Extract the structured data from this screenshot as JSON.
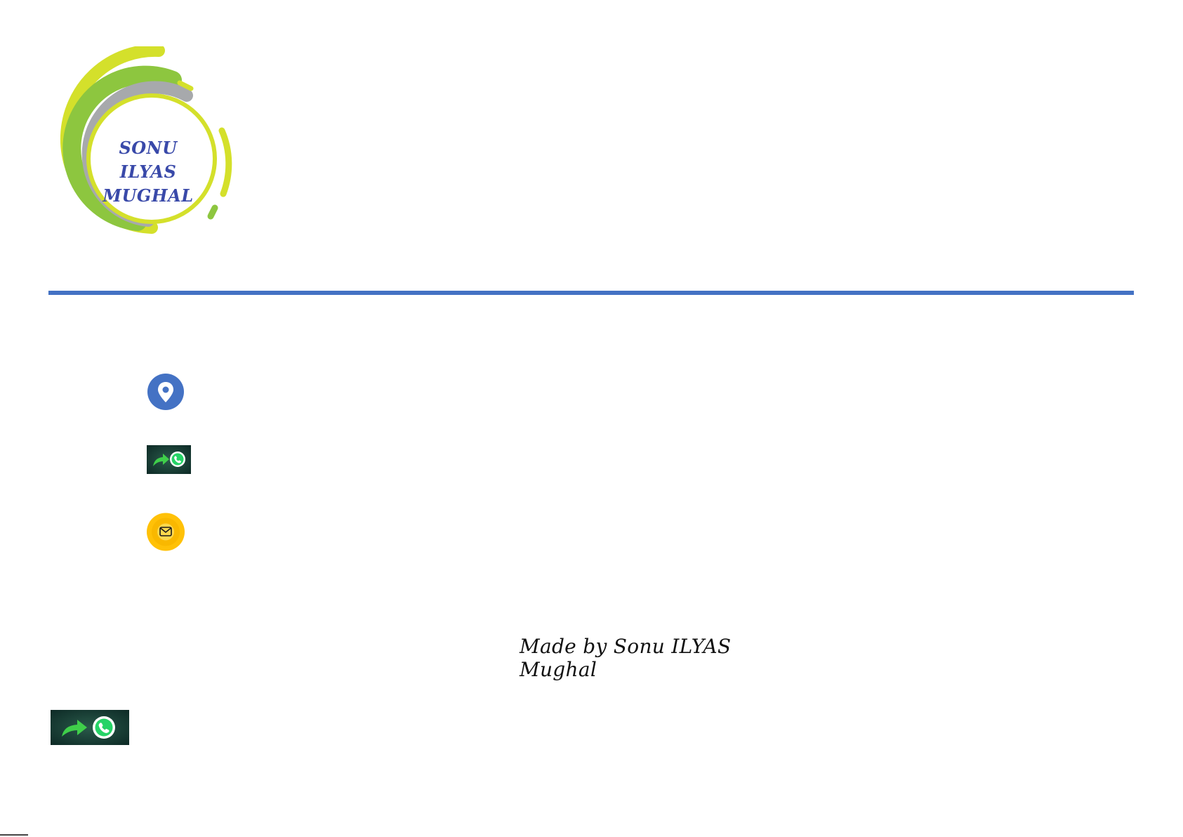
{
  "logo": {
    "line1": "SONU ILYAS",
    "line2": "MUGHAL",
    "colors": {
      "lime": "#d4e02b",
      "green": "#8dc63f",
      "gray": "#a7a9ac",
      "text": "#3949a9"
    }
  },
  "divider": {
    "color": "#4472c4"
  },
  "contacts": {
    "location_icon": "location-pin-icon",
    "whatsapp_icon": "whatsapp-share-icon",
    "mail_icon": "mail-icon"
  },
  "footer": {
    "signature": "Made by Sonu ILYAS Mughal"
  }
}
